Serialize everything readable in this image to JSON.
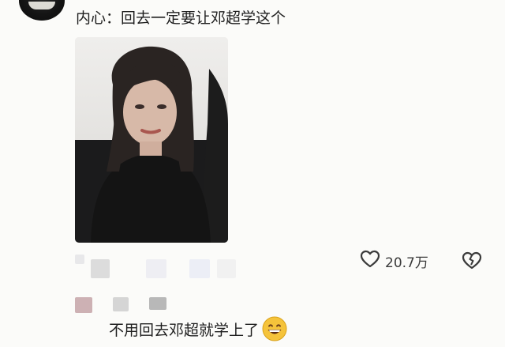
{
  "comment": {
    "text": "内心：回去一定要让邓超学这个",
    "likes": "20.7万",
    "like_icon": "heart-outline-icon",
    "dislike_icon": "broken-heart-icon"
  },
  "reply": {
    "text": "不用回去邓超就学上了",
    "emoji": "grinning-face-emoji"
  }
}
